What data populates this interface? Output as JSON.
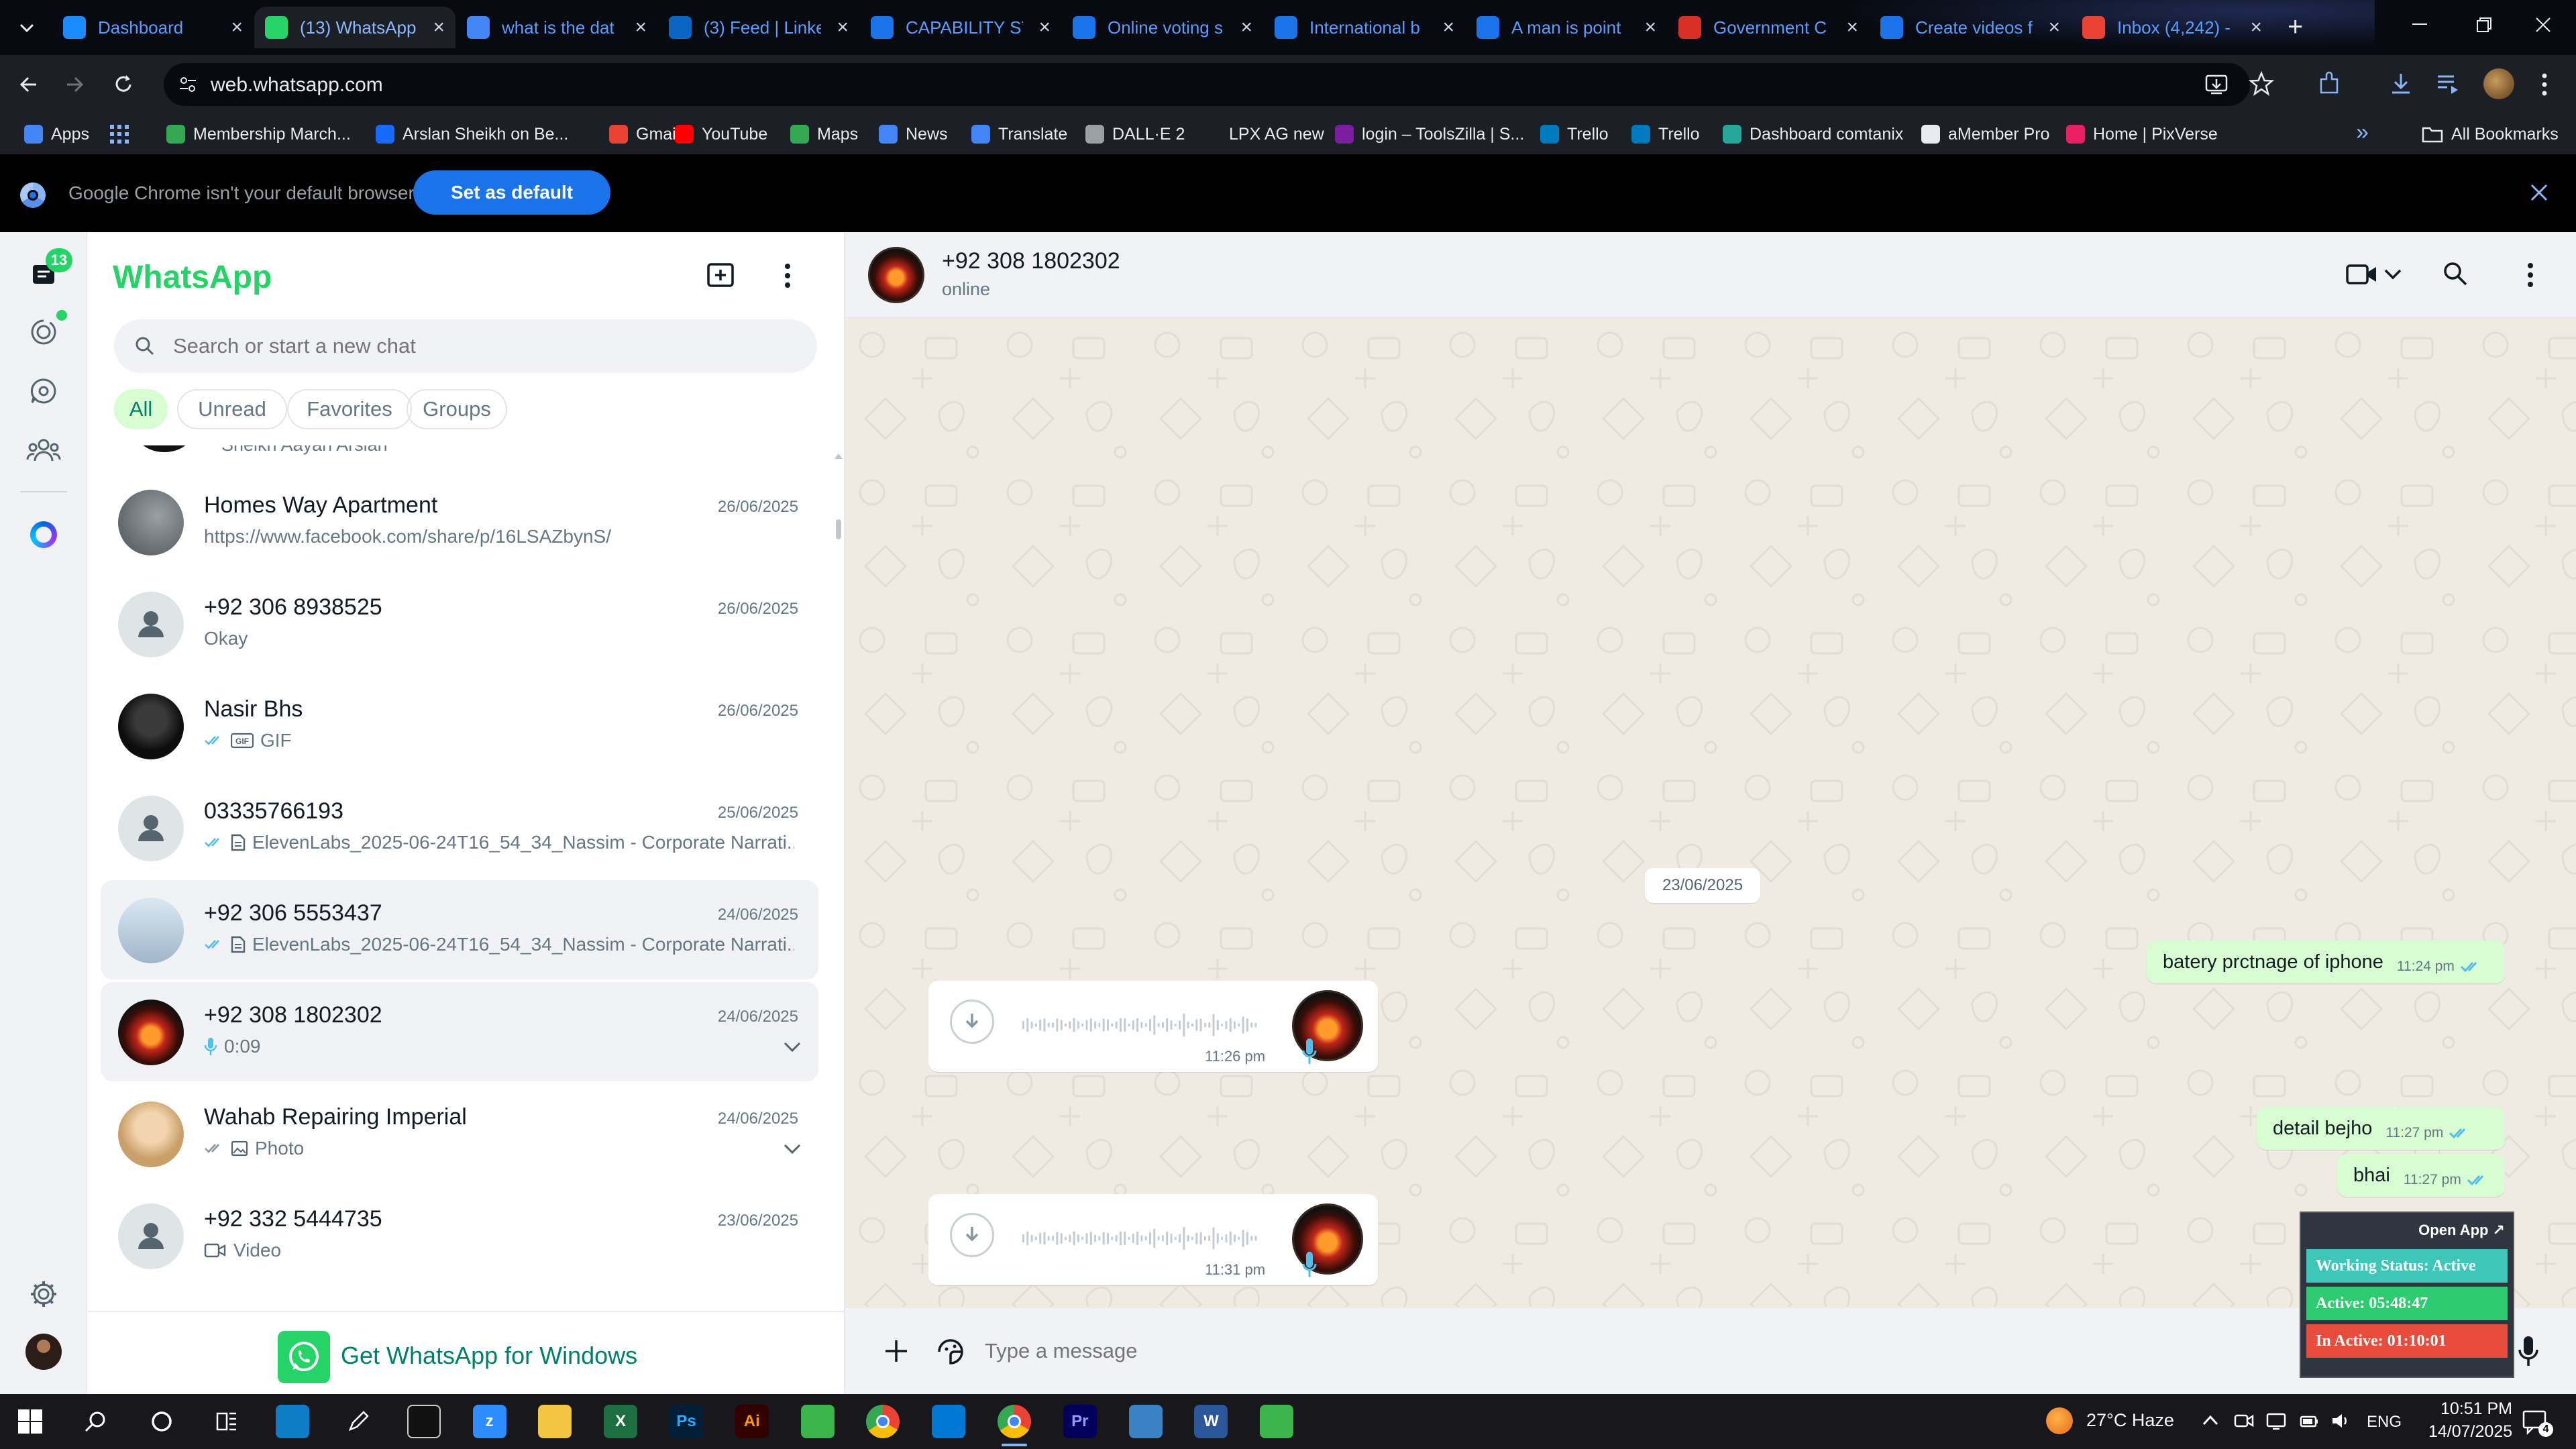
{
  "browser": {
    "tabs": [
      {
        "title": "Dashboard",
        "active": false,
        "color": "#1a8cff",
        "icon": "dashboard-favicon"
      },
      {
        "title": "(13) WhatsApp",
        "active": true,
        "color": "#25d366",
        "icon": "whatsapp-favicon"
      },
      {
        "title": "what is the dat",
        "active": false,
        "color": "#4285f4",
        "icon": "google-favicon"
      },
      {
        "title": "(3) Feed | Linke",
        "active": false,
        "color": "#0a66c2",
        "icon": "linkedin-favicon"
      },
      {
        "title": "CAPABILITY ST",
        "active": false,
        "color": "#1a73e8",
        "icon": "forms-favicon"
      },
      {
        "title": "Online voting s",
        "active": false,
        "color": "#1a73e8",
        "icon": "forms-favicon"
      },
      {
        "title": "International b",
        "active": false,
        "color": "#1a73e8",
        "icon": "forms-favicon"
      },
      {
        "title": "A man is point",
        "active": false,
        "color": "#1a73e8",
        "icon": "forms-favicon"
      },
      {
        "title": "Government C",
        "active": false,
        "color": "#d93025",
        "icon": "gov-favicon"
      },
      {
        "title": "Create videos f",
        "active": false,
        "color": "#1a73e8",
        "icon": "forms-favicon"
      },
      {
        "title": "Inbox (4,242) -",
        "active": false,
        "color": "#ea4335",
        "icon": "gmail-favicon"
      }
    ],
    "url": "web.whatsapp.com",
    "bookmarks": [
      {
        "label": "Apps",
        "color": "#4285f4"
      },
      {
        "label": "Membership March...",
        "color": "#34a853"
      },
      {
        "label": "Arslan Sheikh on Be...",
        "color": "#1769ff"
      },
      {
        "label": "Gmail",
        "color": "#ea4335"
      },
      {
        "label": "YouTube",
        "color": "#ff0000"
      },
      {
        "label": "Maps",
        "color": "#34a853"
      },
      {
        "label": "News",
        "color": "#4285f4"
      },
      {
        "label": "Translate",
        "color": "#4285f4"
      },
      {
        "label": "DALL·E 2",
        "color": "#9aa0a6"
      },
      {
        "label": "LPX AG new",
        "color": "#1c1f26"
      },
      {
        "label": "login – ToolsZilla | S...",
        "color": "#7b1fa2"
      },
      {
        "label": "Trello",
        "color": "#0079bf"
      },
      {
        "label": "Trello",
        "color": "#0079bf"
      },
      {
        "label": "Dashboard comtanix",
        "color": "#26a69a"
      },
      {
        "label": "aMember Pro",
        "color": "#e8eaed"
      },
      {
        "label": "Home | PixVerse",
        "color": "#e91e63"
      }
    ],
    "all_bookmarks": "All Bookmarks",
    "overflow": "»",
    "infobar": {
      "message": "Google Chrome isn't your default browser",
      "button": "Set as default"
    }
  },
  "rail": {
    "unread_badge": "13"
  },
  "sidebar": {
    "title": "WhatsApp",
    "search_placeholder": "Search or start a new chat",
    "filters": [
      "All",
      "Unread",
      "Favorites",
      "Groups"
    ],
    "partial_top": "Sheikh Aayan Arslan",
    "chats": [
      {
        "name": "Homes Way Apartment",
        "time": "26/06/2025",
        "preview": "https://www.facebook.com/share/p/16LSAZbynS/",
        "ticks": false,
        "kind": "text",
        "avatar": "photo-gray"
      },
      {
        "name": "+92 306 8938525",
        "time": "26/06/2025",
        "preview": "Okay",
        "ticks": false,
        "kind": "text",
        "avatar": "default"
      },
      {
        "name": "Nasir Bhs",
        "time": "26/06/2025",
        "preview": "GIF",
        "ticks": true,
        "kind": "gif",
        "avatar": "photo-dark"
      },
      {
        "name": "03335766193",
        "time": "25/06/2025",
        "preview": "ElevenLabs_2025-06-24T16_54_34_Nassim - Corporate Narrati...",
        "ticks": true,
        "kind": "doc",
        "avatar": "default"
      },
      {
        "name": "+92 306 5553437",
        "time": "24/06/2025",
        "preview": "ElevenLabs_2025-06-24T16_54_34_Nassim - Corporate Narrati...",
        "ticks": true,
        "kind": "doc",
        "avatar": "photo-sky"
      },
      {
        "name": "+92 308 1802302",
        "time": "24/06/2025",
        "preview": "0:09",
        "ticks": false,
        "kind": "voice",
        "avatar": "photo-fire",
        "selected": true
      },
      {
        "name": "Wahab Repairing Imperial",
        "time": "24/06/2025",
        "preview": "Photo",
        "ticks": true,
        "kind": "photo",
        "avatar": "photo-child"
      },
      {
        "name": "+92 332 5444735",
        "time": "23/06/2025",
        "preview": "Video",
        "ticks": false,
        "kind": "video",
        "avatar": "default"
      }
    ],
    "get_app": "Get WhatsApp for Windows"
  },
  "conversation": {
    "contact": "+92 308 1802302",
    "status": "online",
    "date_chip": "23/06/2025",
    "messages": [
      {
        "dir": "out",
        "text": "batery prctnage of iphone",
        "time": "11:24 pm"
      },
      {
        "dir": "in",
        "type": "voice",
        "time": "11:26 pm"
      },
      {
        "dir": "out",
        "text": "detail bejho",
        "time": "11:27 pm"
      },
      {
        "dir": "out",
        "text": "bhai",
        "time": "11:27 pm"
      },
      {
        "dir": "in",
        "type": "voice",
        "time": "11:31 pm"
      }
    ],
    "composer_placeholder": "Type a message"
  },
  "extension": {
    "open_label": "Open App ↗",
    "working_status": "Working Status: Active",
    "active": "Active: 05:48:47",
    "inactive": "In Active: 01:10:01",
    "colors": {
      "working": "#3ec7b8",
      "active": "#2ecc71",
      "inactive": "#e74c3c"
    }
  },
  "taskbar": {
    "weather": "27°C Haze",
    "lang": "ENG",
    "time": "10:51 PM",
    "date": "14/07/2025",
    "notif_count": "4",
    "apps": [
      "windows-start",
      "search",
      "cortana",
      "task-view",
      "edge",
      "pen",
      "terminal",
      "zoom",
      "file-explorer",
      "excel",
      "photoshop",
      "illustrator",
      "camtasia",
      "chrome",
      "vscode",
      "chrome-active",
      "premiere",
      "app-blue",
      "word",
      "camtasia-2"
    ]
  },
  "colors": {
    "accent": "#25d366",
    "outgoing_bubble": "#d9fdd3",
    "chat_bg": "#efeae2",
    "tick_blue": "#53bdeb"
  }
}
